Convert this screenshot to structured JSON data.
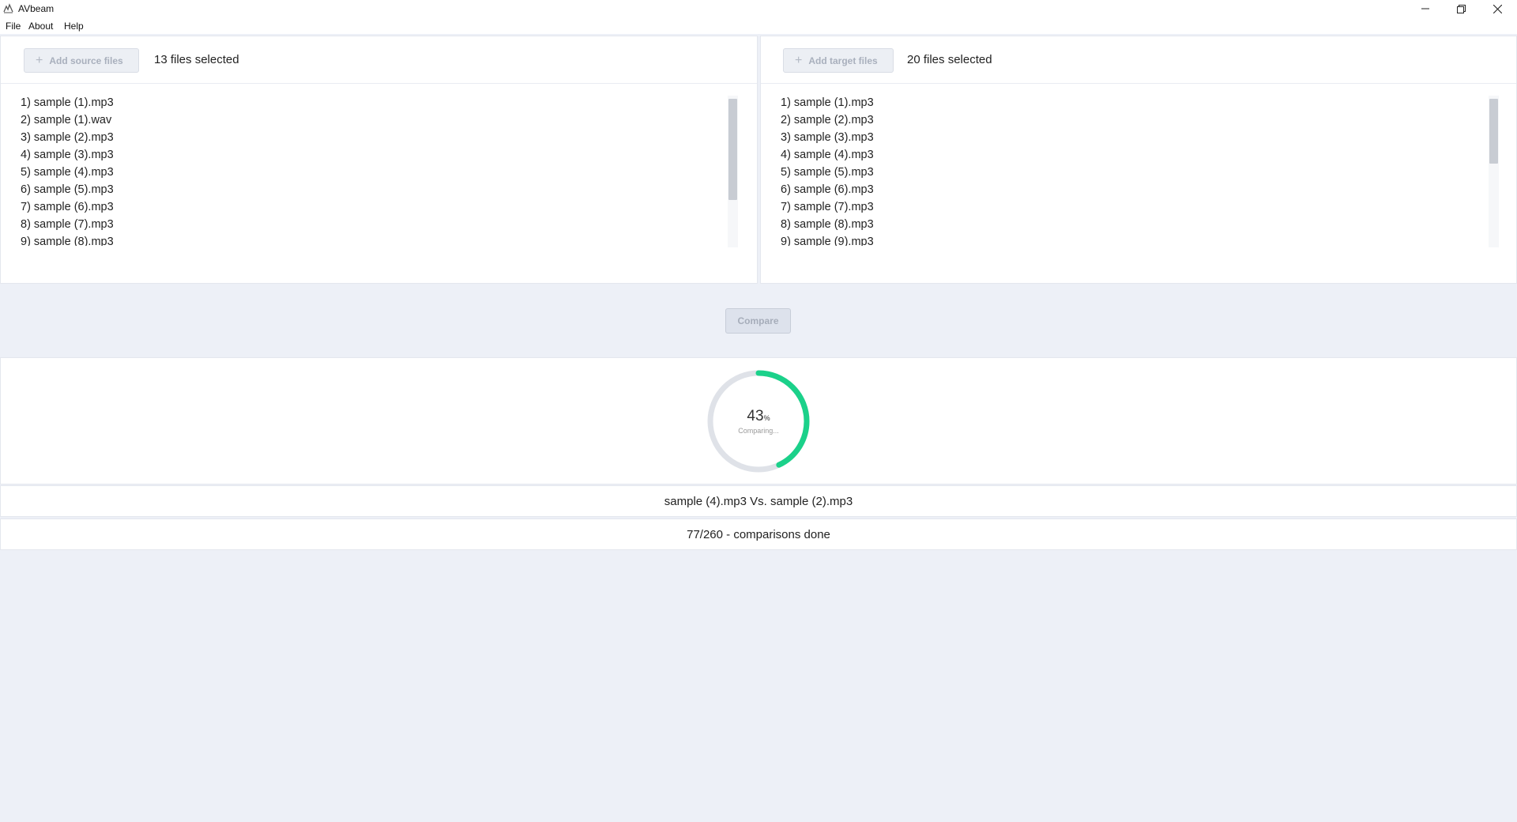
{
  "window": {
    "title": "AVbeam",
    "app_icon": "avbeam-logo-icon",
    "controls": [
      "minimize-icon",
      "restore-icon",
      "close-icon"
    ]
  },
  "menu": {
    "items": [
      "File",
      "About",
      "Help"
    ]
  },
  "source": {
    "add_button_label": "Add source files",
    "count_label": "13 files selected",
    "files": [
      "1) sample (1).mp3",
      "2) sample (1).wav",
      "3) sample (2).mp3",
      "4) sample (3).mp3",
      "5) sample (4).mp3",
      "6) sample (5).mp3",
      "7) sample (6).mp3",
      "8) sample (7).mp3",
      "9) sample (8).mp3"
    ]
  },
  "target": {
    "add_button_label": "Add target files",
    "count_label": "20 files selected",
    "files": [
      "1) sample (1).mp3",
      "2) sample (2).mp3",
      "3) sample (3).mp3",
      "4) sample (4).mp3",
      "5) sample (5).mp3",
      "6) sample (6).mp3",
      "7) sample (7).mp3",
      "8) sample (8).mp3",
      "9) sample (9).mp3"
    ]
  },
  "compare": {
    "label": "Compare"
  },
  "progress": {
    "percent": 43,
    "percent_text": "43",
    "percent_symbol": "%",
    "status": "Comparing...",
    "current_pair": "sample (4).mp3 Vs. sample (2).mp3",
    "done_text": "77/260 - comparisons done"
  },
  "colors": {
    "ring_progress": "#1bd18a",
    "ring_track": "#dfe2e8",
    "background": "#edf0f7"
  }
}
